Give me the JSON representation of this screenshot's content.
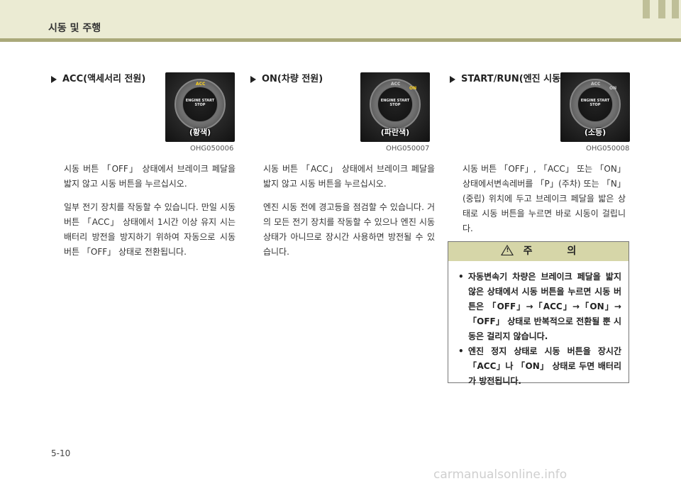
{
  "header": {
    "title": "시동 및 주행"
  },
  "sections": [
    {
      "heading": "ACC(액세서리 전원)",
      "photo": {
        "ring_acc": "ACC",
        "button": "ENGINE START STOP",
        "caption": "(황색)"
      },
      "figure_code": "OHG050006",
      "paragraphs": [
        "시동 버튼 「OFF」 상태에서 브레이크 페달을 밟지 않고 시동 버튼을 누르십시오.",
        "일부 전기 장치를 작동할 수 있습니다. 만일 시동 버튼 「ACC」 상태에서 1시간 이상 유지 시는 배터리 방전을 방지하기 위하여 자동으로 시동 버튼 「OFF」 상태로 전환됩니다."
      ]
    },
    {
      "heading": "ON(차량 전원)",
      "photo": {
        "ring_acc": "ACC",
        "ring_on": "ON",
        "button": "ENGINE START STOP",
        "caption": "(파란색)"
      },
      "figure_code": "OHG050007",
      "paragraphs": [
        "시동 버튼 「ACC」 상태에서 브레이크 페달을 밟지 않고 시동  버튼을 누르십시오.",
        "엔진 시동 전에 경고등을 점검할 수 있습니다. 거의 모든 전기 장치를 작동할 수 있으나 엔진 시동 상태가 아니므로 장시간 사용하면 방전될 수 있습니다."
      ]
    },
    {
      "heading": "START/RUN(엔진 시동)",
      "photo": {
        "ring_acc": "ACC",
        "ring_on": "ON",
        "button": "ENGINE START STOP",
        "caption": "(소등)"
      },
      "figure_code": "OHG050008",
      "paragraphs": [
        "시동 버튼 「OFF」, 「ACC」 또는 「ON」 상태에서변속레버를 「P」(주차) 또는 「N」(중립) 위치에 두고 브레이크 페달을 밟은 상태로 시동 버튼을 누르면 바로 시동이 걸립니다."
      ]
    }
  ],
  "caution": {
    "title": "주 의",
    "items": [
      "자동변속기 차량은 브레이크 페달을 밟지 않은 상태에서 시동 버튼을 누르면 시동 버튼은 「OFF」→「ACC」→「ON」→「OFF」 상태로 반복적으로 전환될 뿐 시동은 걸리지 않습니다.",
      "엔진 정지 상태로 시동 버튼을 장시간 「ACC」나 「ON」 상태로 두면 배터리가 방전됩니다."
    ]
  },
  "page_number": "5-10",
  "watermark": "carmanualsonline.info"
}
